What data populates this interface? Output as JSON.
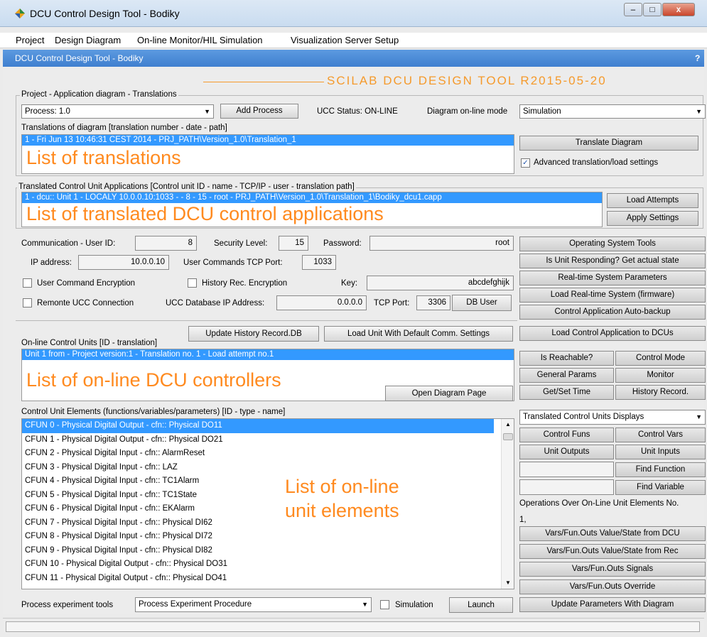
{
  "window": {
    "title": "DCU Control Design Tool - Bodiky",
    "subtitle": "DCU Control Design Tool - Bodiky",
    "help": "?",
    "minimize": "–",
    "maximize": "□",
    "close": "x"
  },
  "menu": [
    "Project",
    "Design Diagram",
    "On-line Monitor/HIL Simulation",
    "Visualization Server Setup"
  ],
  "banner": "SCILAB DCU DESIGN TOOL R2015-05-20",
  "project": {
    "group_label": "Project - Application diagram - Translations",
    "process_select": "Process: 1.0",
    "add_process": "Add Process",
    "ucc_status": "UCC Status: ON-LINE",
    "diagram_mode_label": "Diagram on-line mode",
    "diagram_mode_value": "Simulation",
    "translations_label": "Translations of diagram [translation number - date - path]",
    "translation_row": "1  -  Fri Jun 13 10:46:31 CEST 2014  -  PRJ_PATH\\Version_1.0\\Translation_1",
    "translations_overlay": "List of translations",
    "translate_button": "Translate Diagram",
    "advanced_checkbox": "Advanced translation/load settings"
  },
  "apps": {
    "group_label": "Translated Control Unit Applications [Control unit ID - name - TCP/IP - user - translation path]",
    "app_row": "1  -  dcu:: Unit 1  -  LOCALY 10.0.0.10:1033  -   - 8  -  15  -  root  -  PRJ_PATH\\Version_1.0\\Translation_1\\Bodiky_dcu1.capp",
    "overlay": "List of translated DCU control applications",
    "load_attempts": "Load Attempts",
    "apply_settings": "Apply Settings"
  },
  "comm": {
    "user_id_label": "Communication - User ID:",
    "user_id": "8",
    "security_label": "Security Level:",
    "security": "15",
    "password_label": "Password:",
    "password": "root",
    "ip_label": "IP address:",
    "ip": "10.0.0.10",
    "port_label": "User Commands TCP Port:",
    "port": "1033",
    "user_encryption": "User Command Encryption",
    "history_encryption": "History Rec. Encryption",
    "key_label": "Key:",
    "key": "abcdefghijk",
    "remote_ucc": "Remonte UCC Connection",
    "db_ip_label": "UCC Database IP Address:",
    "db_ip": "0.0.0.0",
    "db_port_label": "TCP Port:",
    "db_port": "3306",
    "db_user": "DB User"
  },
  "right_buttons": [
    "Operating System Tools",
    "Is Unit Responding? Get actual state",
    "Real-time System Parameters",
    "Load Real-time System (firmware)",
    "Control Application Auto-backup",
    "Load Control Application to DCUs"
  ],
  "online": {
    "update_history": "Update History Record.DB",
    "load_default": "Load Unit With Default Comm. Settings",
    "label": "On-line Control Units [ID - translation]",
    "row": "Unit 1 from - Project version:1 - Translation no. 1 - Load attempt no.1",
    "overlay": "List of on-line DCU controllers",
    "open_diagram": "Open Diagram Page",
    "grid_buttons": [
      "Is Reachable?",
      "Control Mode",
      "General Params",
      "Monitor",
      "Get/Set Time",
      "History Record."
    ]
  },
  "elements": {
    "label": "Control Unit Elements (functions/variables/parameters) [ID - type - name]",
    "rows": [
      "CFUN 0 - Physical Digital Output - cfn:: Physical DO11",
      "CFUN 1 - Physical Digital Output - cfn:: Physical DO21",
      "CFUN 2 - Physical Digital Input - cfn:: AlarmReset",
      "CFUN 3 - Physical Digital Input - cfn:: LAZ",
      "CFUN 4 - Physical Digital Input - cfn:: TC1Alarm",
      "CFUN 5 - Physical Digital Input - cfn:: TC1State",
      "CFUN 6 - Physical Digital Input - cfn:: EKAlarm",
      "CFUN 7 - Physical Digital Input - cfn:: Physical DI62",
      "CFUN 8 - Physical Digital Input - cfn:: Physical DI72",
      "CFUN 9 - Physical Digital Input - cfn:: Physical DI82",
      "CFUN 10 - Physical Digital Output - cfn:: Physical DO31",
      "CFUN 11 - Physical Digital Output - cfn:: Physical DO41"
    ],
    "overlay_line1": "List of on-line",
    "overlay_line2": "unit elements"
  },
  "displays": {
    "select": "Translated Control Units Displays",
    "grid": [
      "Control Funs",
      "Control Vars",
      "Unit Outputs",
      "Unit Inputs"
    ],
    "find_function": "Find Function",
    "find_variable": "Find Variable",
    "ops_label": "Operations Over On-Line Unit Elements No.",
    "ops_value": "1,",
    "ops_buttons": [
      "Vars/Fun.Outs Value/State from DCU",
      "Vars/Fun.Outs Value/State from Rec",
      "Vars/Fun.Outs Signals",
      "Vars/Fun.Outs Override",
      "Update Parameters With Diagram"
    ]
  },
  "bottom": {
    "tools_label": "Process experiment tools",
    "procedure": "Process Experiment Procedure",
    "simulation": "Simulation",
    "launch": "Launch"
  }
}
